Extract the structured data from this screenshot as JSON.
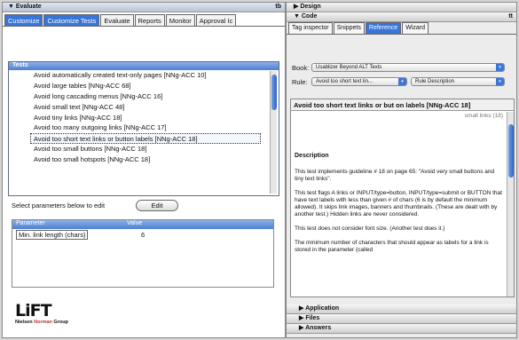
{
  "left": {
    "panel_title": "▼ Evaluate",
    "panel_right": "tb",
    "tabs": [
      "Customize",
      "Customize Tests",
      "Evaluate",
      "Reports",
      "Monitor",
      "Approval Ic"
    ],
    "tests_header": "Tests",
    "tests": [
      "Avoid automatically created text-only pages [NNg-ACC 10]",
      "Avoid large tables [NNg-ACC 68]",
      "Avoid long cascading menus [NNg-ACC 16]",
      "Avoid small text [NNg-ACC 48]",
      "Avoid tiny links [NNg-ACC 18]",
      "Avoid too many outgoing links [NNg-ACC 17]",
      "Avoid too short text links or button labels [NNg-ACC 18]",
      "Avoid too small buttons [NNg-ACC 18]",
      "Avoid too small hotspots [NNg-ACC 18]"
    ],
    "selected_test_index": 6,
    "select_label": "Select parameters below to edit",
    "edit_button": "Edit",
    "param_headers": [
      "Parameter",
      "Value"
    ],
    "param_rows": [
      {
        "name": "Min. link length (chars)",
        "value": "6"
      }
    ],
    "logo_text": "LiFT",
    "logo_sub_a": "Nielsen",
    "logo_sub_b": "Norman",
    "logo_sub_c": "Group"
  },
  "right": {
    "design": "▶ Design",
    "code": "▼ Code",
    "code_right": "tt",
    "tabs": [
      "Tag inspector",
      "Snippets",
      "Reference",
      "Wizard"
    ],
    "book_label": "Book:",
    "book_value": "Usablizer Beyond ALT Texts",
    "rule_label": "Rule:",
    "rule_value": "Avoid too short text lin...",
    "rule_desc": "Rule Description",
    "doc_title": "Avoid too short text links or but on labels [NNg-ACC 18]",
    "doc_sub": "small links (18)",
    "desc_heading": "Description",
    "paragraphs": [
      "This test implements guideline # 18 on page 65: \"Avoid very small buttons and tiny text links\".",
      "This test flags A links or INPUT/type=button, INPUT/type=submit or BUTTON that have text labels with less than given # of chars (6 is by default the minimum allowed). It skips link images, banners and thumbnails. (These are dealt with by another test.) Hidden links are never considered.",
      "This test does not consider font size. (Another test does it.)",
      "The minimum number of characters that should appear as labels for a link is stored in the parameter (called"
    ],
    "bottom_sections": [
      "▶ Application",
      "▶ Files",
      "▶ Answers"
    ]
  },
  "colors": {
    "accent": "#3875d7",
    "header": "#4d7fd0"
  }
}
